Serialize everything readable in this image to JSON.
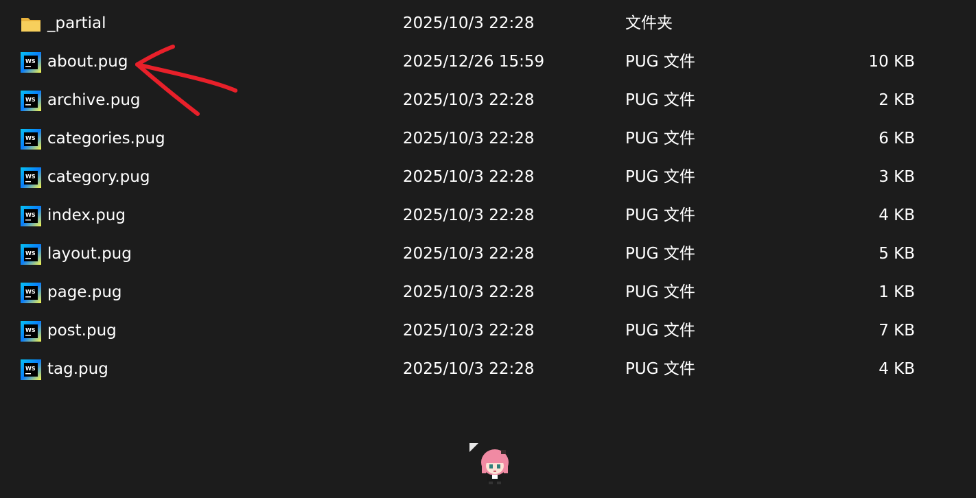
{
  "files": [
    {
      "name": "_partial",
      "modified": "2025/10/3 22:28",
      "type": "文件夹",
      "size": "",
      "icon": "folder-icon"
    },
    {
      "name": "about.pug",
      "modified": "2025/12/26 15:59",
      "type": "PUG 文件",
      "size": "10 KB",
      "icon": "webstorm-file-icon"
    },
    {
      "name": "archive.pug",
      "modified": "2025/10/3 22:28",
      "type": "PUG 文件",
      "size": "2 KB",
      "icon": "webstorm-file-icon"
    },
    {
      "name": "categories.pug",
      "modified": "2025/10/3 22:28",
      "type": "PUG 文件",
      "size": "6 KB",
      "icon": "webstorm-file-icon"
    },
    {
      "name": "category.pug",
      "modified": "2025/10/3 22:28",
      "type": "PUG 文件",
      "size": "3 KB",
      "icon": "webstorm-file-icon"
    },
    {
      "name": "index.pug",
      "modified": "2025/10/3 22:28",
      "type": "PUG 文件",
      "size": "4 KB",
      "icon": "webstorm-file-icon"
    },
    {
      "name": "layout.pug",
      "modified": "2025/10/3 22:28",
      "type": "PUG 文件",
      "size": "5 KB",
      "icon": "webstorm-file-icon"
    },
    {
      "name": "page.pug",
      "modified": "2025/10/3 22:28",
      "type": "PUG 文件",
      "size": "1 KB",
      "icon": "webstorm-file-icon"
    },
    {
      "name": "post.pug",
      "modified": "2025/10/3 22:28",
      "type": "PUG 文件",
      "size": "7 KB",
      "icon": "webstorm-file-icon"
    },
    {
      "name": "tag.pug",
      "modified": "2025/10/3 22:28",
      "type": "PUG 文件",
      "size": "4 KB",
      "icon": "webstorm-file-icon"
    }
  ],
  "colors": {
    "background": "#1c1c1c",
    "text": "#ffffff",
    "annotation_arrow": "#e8202a",
    "folder": "#f2c54b"
  }
}
